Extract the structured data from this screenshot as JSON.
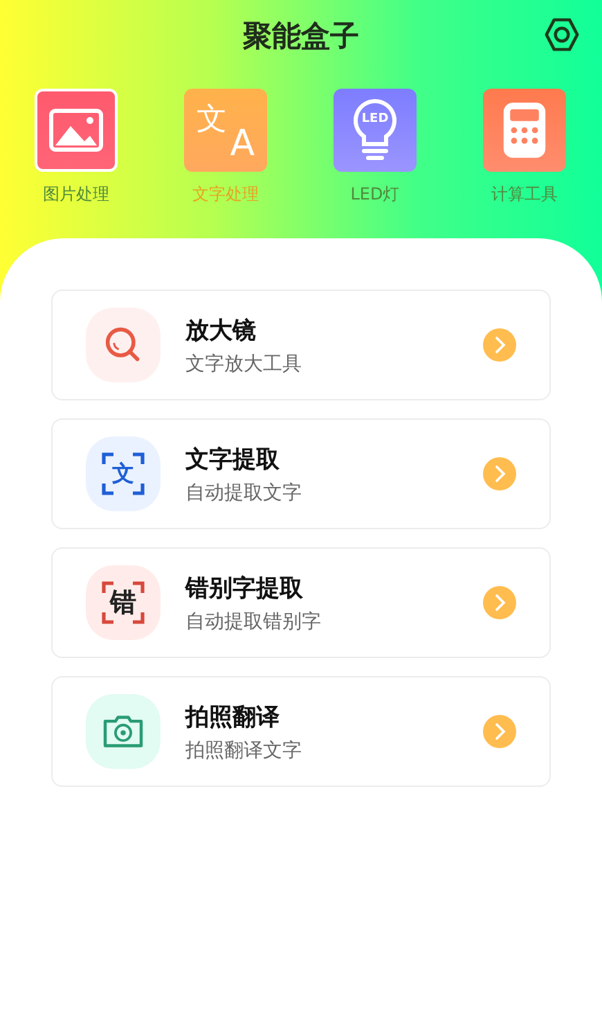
{
  "header": {
    "title": "聚能盒子"
  },
  "tools": [
    {
      "kind": "image",
      "label": "图片处理",
      "selected": false
    },
    {
      "kind": "translate",
      "label": "文字处理",
      "selected": true,
      "icon_text": [
        "文",
        "A"
      ]
    },
    {
      "kind": "bulb",
      "label": "LED灯",
      "selected": false,
      "icon_text": [
        "LED"
      ]
    },
    {
      "kind": "calculator",
      "label": "计算工具",
      "selected": false
    }
  ],
  "features": [
    {
      "kind": "magnifier",
      "title": "放大镜",
      "subtitle": "文字放大工具"
    },
    {
      "kind": "scan",
      "title": "文字提取",
      "subtitle": "自动提取文字",
      "icon_text": "文"
    },
    {
      "kind": "typo",
      "title": "错别字提取",
      "subtitle": "自动提取错别字",
      "icon_text": "错"
    },
    {
      "kind": "camera",
      "title": "拍照翻译",
      "subtitle": "拍照翻译文字"
    }
  ]
}
